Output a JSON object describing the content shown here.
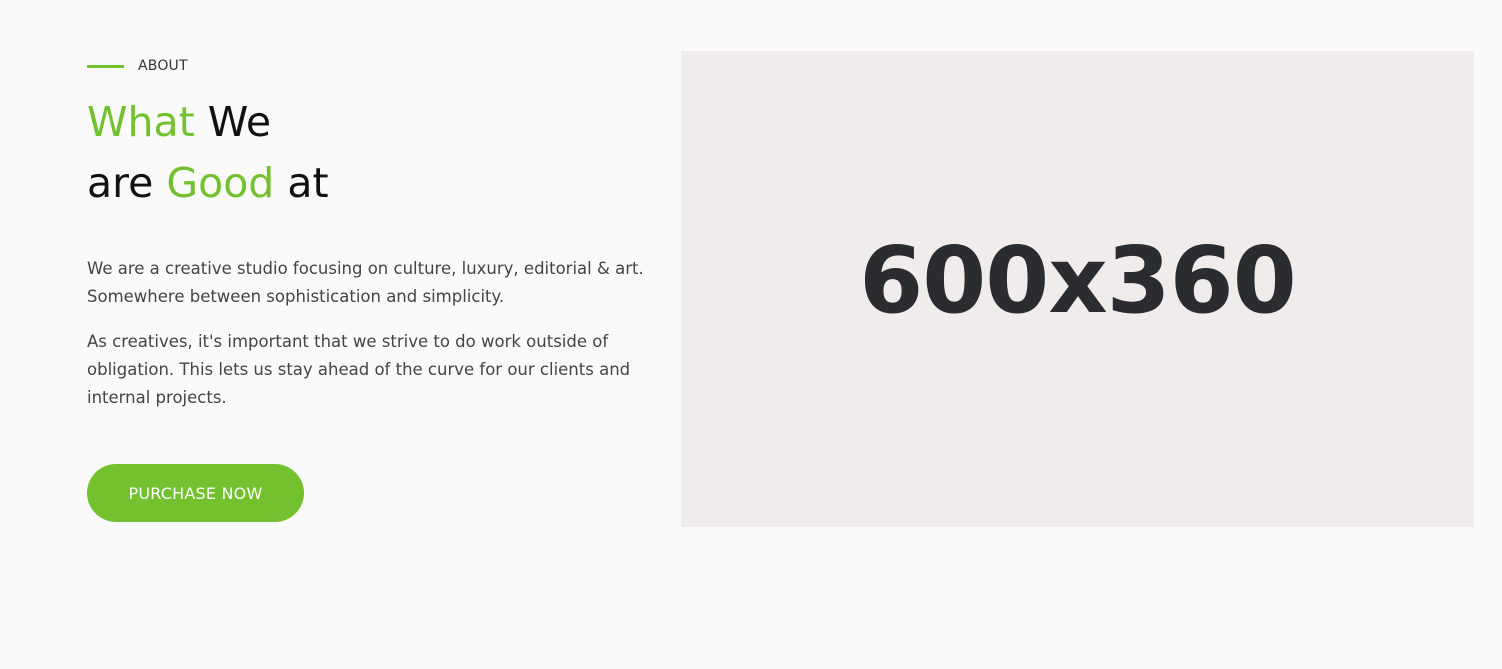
{
  "about": {
    "eyebrow": "ABOUT",
    "heading": {
      "line1_accent": "What",
      "line1_rest": "We",
      "line2_start": "are",
      "line2_accent": "Good",
      "line2_end": "at"
    },
    "paragraph1": "We are a creative studio focusing on culture, luxury, editorial & art. Somewhere between sophistication and simplicity.",
    "paragraph2": "As creatives, it's important that we strive to do work outside of obligation. This lets us stay ahead of the curve for our clients and internal projects.",
    "cta_label": "PURCHASE NOW"
  },
  "image": {
    "placeholder_text": "600x360"
  },
  "colors": {
    "accent": "#74c12f",
    "background": "#fafafa",
    "placeholder_bg": "#f1ecec",
    "placeholder_text": "#2b2c2f"
  }
}
